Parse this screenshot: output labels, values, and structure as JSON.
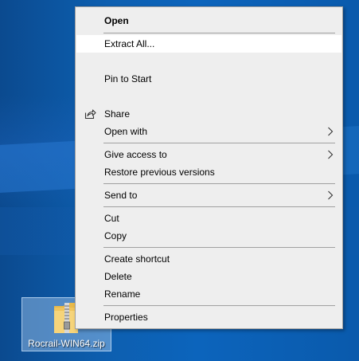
{
  "context_menu": {
    "items": [
      {
        "label": "Open"
      },
      {
        "label": "Extract All..."
      },
      {
        "label": "Pin to Start"
      },
      {
        "label": "Share"
      },
      {
        "label": "Open with"
      },
      {
        "label": "Give access to"
      },
      {
        "label": "Restore previous versions"
      },
      {
        "label": "Send to"
      },
      {
        "label": "Cut"
      },
      {
        "label": "Copy"
      },
      {
        "label": "Create shortcut"
      },
      {
        "label": "Delete"
      },
      {
        "label": "Rename"
      },
      {
        "label": "Properties"
      }
    ],
    "highlighted_item": "Extract All...",
    "icons": {
      "share": "share-icon",
      "submenu": "chevron-right-icon"
    }
  },
  "desktop": {
    "file": {
      "name": "Rocrail-WIN64.zip",
      "icon": "zip-folder-icon",
      "selected": true
    }
  },
  "colors": {
    "menu_background": "#eeeeee",
    "highlight": "#ffffff",
    "separator": "#a0a0a0",
    "desktop": "#0c5aa8",
    "selection": "#aacdf0"
  }
}
